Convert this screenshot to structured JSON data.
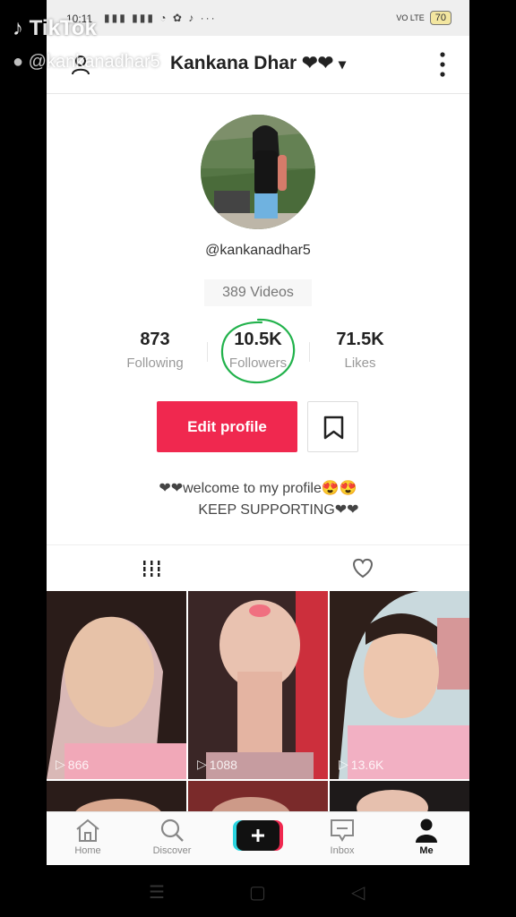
{
  "status_bar": {
    "time": "10:11",
    "network": "VO LTE",
    "battery": "70"
  },
  "header": {
    "title": "Kankana Dhar ❤❤",
    "dropdown": "▾"
  },
  "profile": {
    "handle": "@kankanadhar5",
    "videos_label": "389 Videos",
    "stats": [
      {
        "value": "873",
        "label": "Following"
      },
      {
        "value": "10.5K",
        "label": "Followers"
      },
      {
        "value": "71.5K",
        "label": "Likes"
      }
    ],
    "edit_label": "Edit profile",
    "bio_line1": "❤❤welcome to my profile😍😍",
    "bio_line2": "KEEP SUPPORTING❤❤"
  },
  "videos": [
    {
      "views": "866"
    },
    {
      "views": "1088"
    },
    {
      "views": "13.6K"
    }
  ],
  "bottom_nav": [
    {
      "label": "Home",
      "icon": "home-icon"
    },
    {
      "label": "Discover",
      "icon": "search-icon"
    },
    {
      "label": "",
      "icon": "plus-icon"
    },
    {
      "label": "Inbox",
      "icon": "inbox-icon"
    },
    {
      "label": "Me",
      "icon": "profile-icon"
    }
  ],
  "watermark": {
    "brand": "TikTok",
    "user": "@kankanadhar5"
  },
  "colors": {
    "accent": "#f0284f",
    "circle": "#22b24c"
  }
}
